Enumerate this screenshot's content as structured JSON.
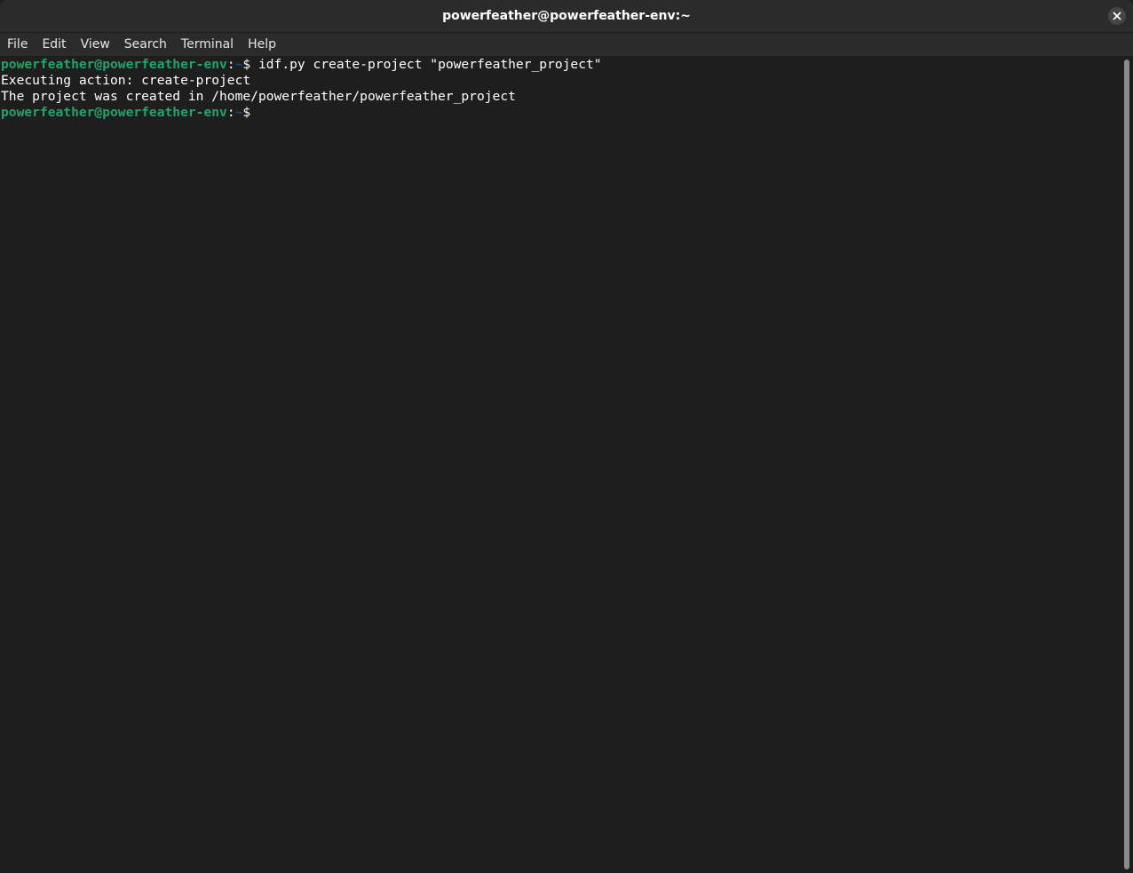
{
  "window": {
    "title": "powerfeather@powerfeather-env:~"
  },
  "menu": [
    {
      "label": "File"
    },
    {
      "label": "Edit"
    },
    {
      "label": "View"
    },
    {
      "label": "Search"
    },
    {
      "label": "Terminal"
    },
    {
      "label": "Help"
    }
  ],
  "terminal": {
    "line1": {
      "user_host": "powerfeather@powerfeather-env",
      "sep": ":",
      "path": "~",
      "dollar": "$ ",
      "command": "idf.py create-project \"powerfeather_project\""
    },
    "line2": "Executing action: create-project",
    "line3": "The project was created in /home/powerfeather/powerfeather_project",
    "line4": {
      "user_host": "powerfeather@powerfeather-env",
      "sep": ":",
      "path": "~",
      "dollar": "$ "
    }
  },
  "colors": {
    "background": "#1e1e1e",
    "prompt_user": "#26a269",
    "prompt_path": "#12488b",
    "text": "#ffffff"
  },
  "icons": {
    "close": "close-icon"
  }
}
